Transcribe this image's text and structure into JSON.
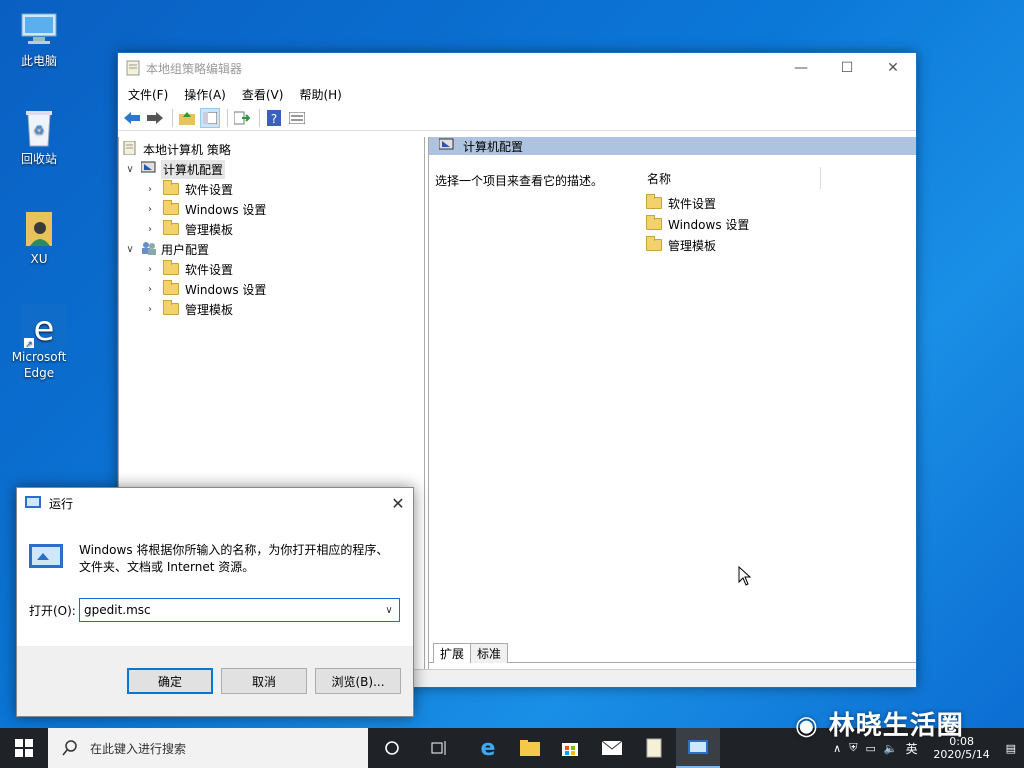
{
  "desktop": {
    "icons": [
      {
        "label": "此电脑"
      },
      {
        "label": "回收站"
      },
      {
        "label": "XU"
      },
      {
        "label": "Microsoft Edge"
      }
    ]
  },
  "window": {
    "title": "本地组策略编辑器",
    "menu": [
      "文件(F)",
      "操作(A)",
      "查看(V)",
      "帮助(H)"
    ],
    "tree": {
      "root": "本地计算机 策略",
      "computer": "计算机配置",
      "computer_children": [
        "软件设置",
        "Windows 设置",
        "管理模板"
      ],
      "user": "用户配置",
      "user_children": [
        "软件设置",
        "Windows 设置",
        "管理模板"
      ]
    },
    "right": {
      "header": "计算机配置",
      "description": "选择一个项目来查看它的描述。",
      "column": "名称",
      "items": [
        "软件设置",
        "Windows 设置",
        "管理模板"
      ],
      "tabs": [
        "扩展",
        "标准"
      ]
    }
  },
  "run": {
    "title": "运行",
    "message": "Windows 将根据你所输入的名称，为你打开相应的程序、文件夹、文档或 Internet 资源。",
    "open_label": "打开(O):",
    "input_value": "gpedit.msc",
    "ok": "确定",
    "cancel": "取消",
    "browse": "浏览(B)..."
  },
  "taskbar": {
    "search_placeholder": "在此键入进行搜索",
    "date": "2020/5/14",
    "time": "0:08",
    "ime": "英"
  },
  "watermark": "林晓生活圈"
}
